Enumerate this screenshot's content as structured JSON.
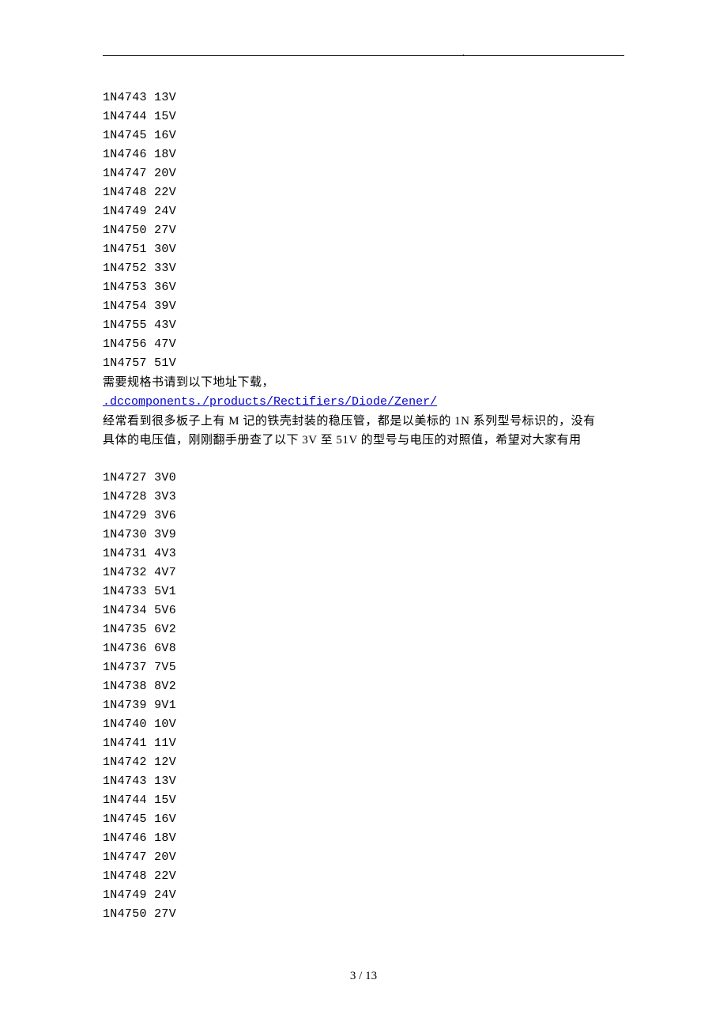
{
  "header_dot": ".",
  "list1": [
    {
      "part": "1N4743",
      "voltage": "13V"
    },
    {
      "part": "1N4744",
      "voltage": "15V"
    },
    {
      "part": "1N4745",
      "voltage": "16V"
    },
    {
      "part": "1N4746",
      "voltage": "18V"
    },
    {
      "part": "1N4747",
      "voltage": "20V"
    },
    {
      "part": "1N4748",
      "voltage": "22V"
    },
    {
      "part": "1N4749",
      "voltage": "24V"
    },
    {
      "part": "1N4750",
      "voltage": "27V"
    },
    {
      "part": "1N4751",
      "voltage": "30V"
    },
    {
      "part": "1N4752",
      "voltage": "33V"
    },
    {
      "part": "1N4753",
      "voltage": "36V"
    },
    {
      "part": "1N4754",
      "voltage": "39V"
    },
    {
      "part": "1N4755",
      "voltage": "43V"
    },
    {
      "part": "1N4756",
      "voltage": "47V"
    },
    {
      "part": "1N4757",
      "voltage": "51V"
    }
  ],
  "download_text": "需要规格书请到以下地址下载，",
  "link_text": ".dccomponents./products/Rectifiers/Diode/Zener/",
  "paragraph_line1": "经常看到很多板子上有 M 记的铁壳封装的稳压管，都是以美标的 1N 系列型号标识的，没有",
  "paragraph_line2": "具体的电压值，刚刚翻手册查了以下 3V 至 51V 的型号与电压的对照值，希望对大家有用",
  "list2": [
    {
      "part": "1N4727",
      "voltage": "3V0"
    },
    {
      "part": "1N4728",
      "voltage": "3V3"
    },
    {
      "part": "1N4729",
      "voltage": "3V6"
    },
    {
      "part": "1N4730",
      "voltage": "3V9"
    },
    {
      "part": "1N4731",
      "voltage": "4V3"
    },
    {
      "part": "1N4732",
      "voltage": "4V7"
    },
    {
      "part": "1N4733",
      "voltage": "5V1"
    },
    {
      "part": "1N4734",
      "voltage": "5V6"
    },
    {
      "part": "1N4735",
      "voltage": "6V2"
    },
    {
      "part": "1N4736",
      "voltage": "6V8"
    },
    {
      "part": "1N4737",
      "voltage": "7V5"
    },
    {
      "part": "1N4738",
      "voltage": "8V2"
    },
    {
      "part": "1N4739",
      "voltage": "9V1"
    },
    {
      "part": "1N4740",
      "voltage": "10V"
    },
    {
      "part": "1N4741",
      "voltage": "11V"
    },
    {
      "part": "1N4742",
      "voltage": "12V"
    },
    {
      "part": "1N4743",
      "voltage": "13V"
    },
    {
      "part": "1N4744",
      "voltage": "15V"
    },
    {
      "part": "1N4745",
      "voltage": "16V"
    },
    {
      "part": "1N4746",
      "voltage": "18V"
    },
    {
      "part": "1N4747",
      "voltage": "20V"
    },
    {
      "part": "1N4748",
      "voltage": "22V"
    },
    {
      "part": "1N4749",
      "voltage": "24V"
    },
    {
      "part": "1N4750",
      "voltage": "27V"
    }
  ],
  "page_number": "3 / 13"
}
